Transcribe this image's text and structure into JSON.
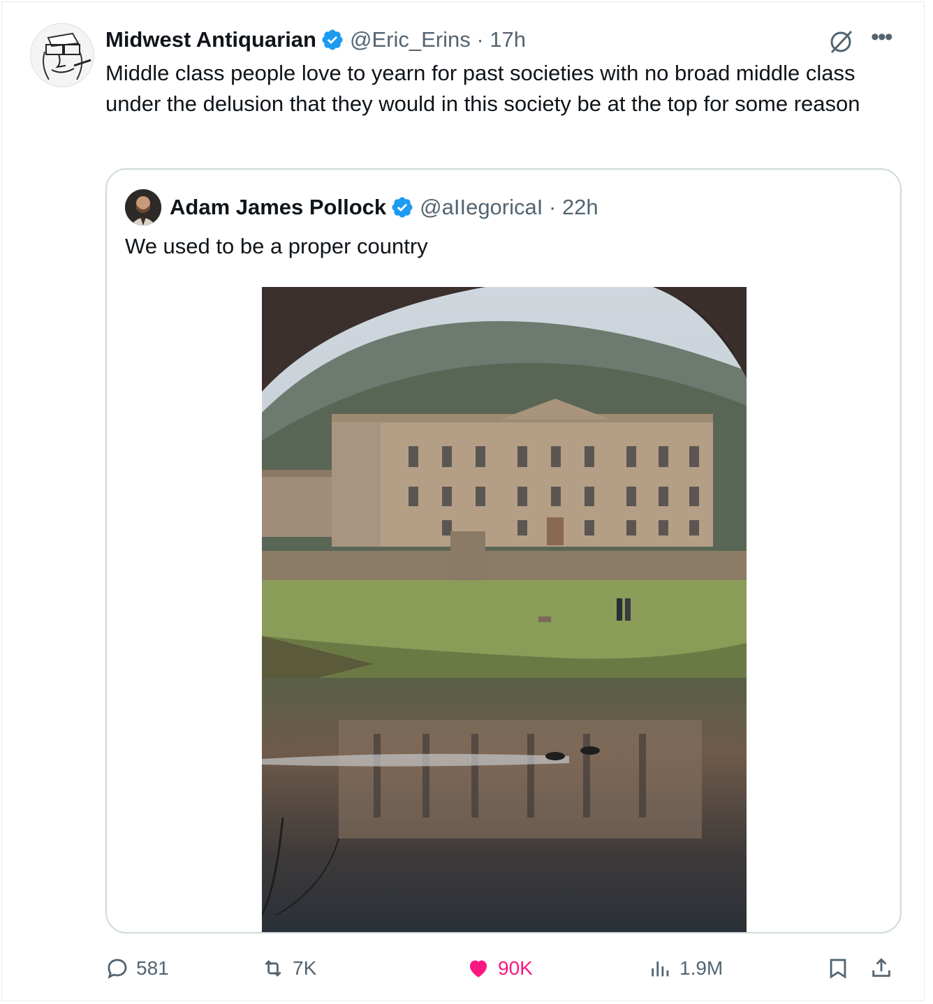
{
  "author": {
    "display_name": "Midwest Antiquarian",
    "handle": "@Eric_Erins",
    "time": "17h",
    "verified": true
  },
  "tweet": {
    "text": "Middle class people love to yearn for past societies with no broad middle class under the delusion that they would in this society be at the top for some reason"
  },
  "quoted": {
    "display_name": "Adam James Pollock",
    "handle": "@aIIegoricaI",
    "time": "22h",
    "verified": true,
    "text": "We used to be a proper country"
  },
  "actions": {
    "replies": "581",
    "reposts": "7K",
    "likes": "90K",
    "views": "1.9M"
  },
  "colors": {
    "verified": "#1d9bf0",
    "like": "#f91880",
    "muted": "#536471",
    "border": "#cfd9de"
  },
  "icons": [
    "grok-icon",
    "more-icon",
    "reply-icon",
    "repost-icon",
    "heart-icon",
    "views-icon",
    "bookmark-icon",
    "share-icon"
  ]
}
